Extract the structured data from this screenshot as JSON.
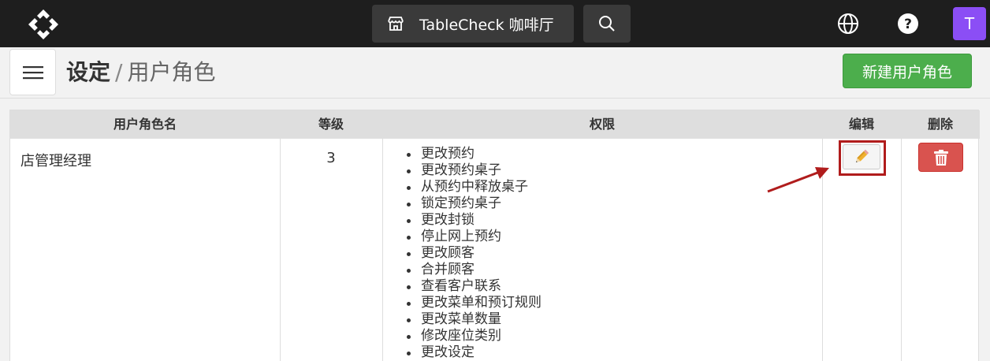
{
  "topbar": {
    "venue_label": "TableCheck 咖啡厅",
    "avatar_initial": "T",
    "icons": {
      "logo": "tablecheck-logo-icon",
      "store": "store-icon",
      "search": "search-icon",
      "language": "globe-icon",
      "help": "help-icon"
    }
  },
  "header": {
    "title_main": "设定",
    "title_separator": "/",
    "title_sub": "用户角色",
    "new_role_button": "新建用户角色",
    "menu_icon": "hamburger-menu-icon"
  },
  "table": {
    "headers": [
      "用户角色名",
      "等级",
      "权限",
      "编辑",
      "删除"
    ],
    "rows": [
      {
        "name": "店管理经理",
        "level": "3",
        "permissions": [
          "更改预约",
          "更改预约桌子",
          "从预约中释放桌子",
          "锁定预约桌子",
          "更改封锁",
          "停止网上预约",
          "更改顾客",
          "合并顾客",
          "查看客户联系",
          "更改菜单和预订规则",
          "更改菜单数量",
          "修改座位类别",
          "更改设定"
        ],
        "edit_icon": "pencil-icon",
        "delete_icon": "trash-icon"
      }
    ]
  },
  "colors": {
    "topbar": "#1e1e1e",
    "accent_green": "#4cae4c",
    "delete_red": "#d9534f",
    "highlight": "#b01c1c",
    "avatar": "#8b4ef5"
  }
}
